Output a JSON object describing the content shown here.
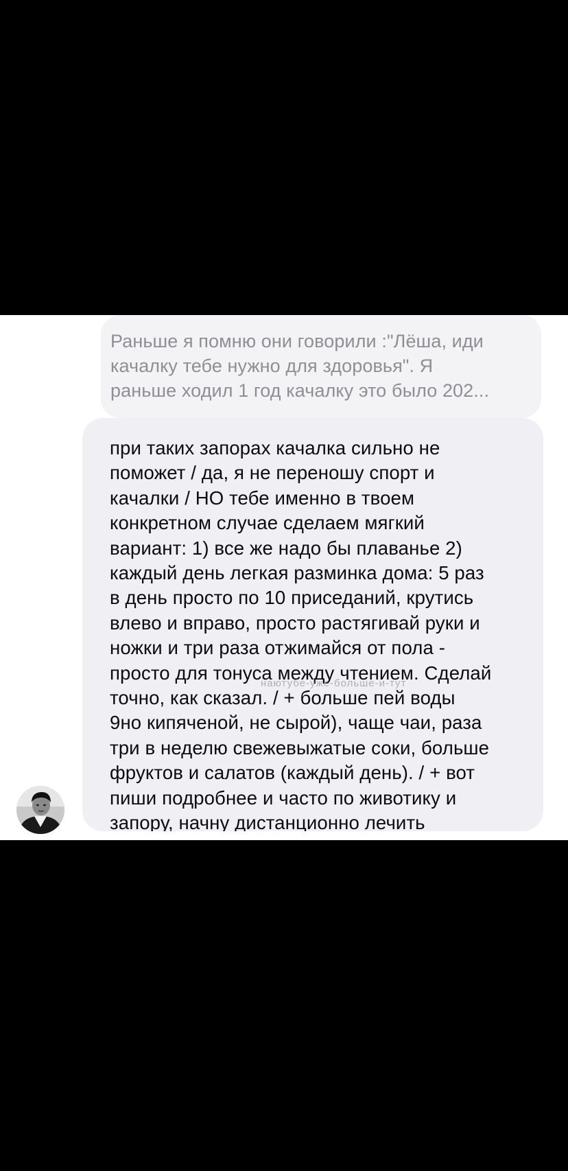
{
  "conversation": {
    "reply_quote": {
      "text": "Раньше я помню они говорили :\"Лёша, иди\nкачалку тебе нужно для здоровья\". Я\nраньше ходил 1 год качалку это было 202..."
    },
    "message": {
      "text": "при таких запорах качалка сильно не\nпоможет / да, я не переношу спорт и\nкачалки / НО тебе именно в твоем\nконкретном случае сделаем мягкий\nвариант: 1) все же надо бы плаванье 2)\nкаждый день легкая разминка дома: 5 раз\nв день просто по 10 приседаний, крутись\nвлево и вправо, просто растягивай руки и\nножки и три раза отжимайся от пола -\nпросто для тонуса между чтением. Сделай\nточно, как сказал. / + больше пей воды\n9но кипяченой, не сырой), чаще чаи, раза\nтри в неделю свежевыжатые соки, больше\nфруктов и салатов (каждый день). / + вот\nпиши подробнее и часто по животику и\nзапору, начну дистанционно лечить"
    },
    "sender_avatar": {
      "icon": "person-photo-icon"
    }
  },
  "colors": {
    "background": "#ffffff",
    "letterbox": "#000000",
    "bubble": "#f0f0f4",
    "quote_bubble": "#f3f3f6",
    "quote_text": "#8e8e95",
    "message_text": "#0c0c0e"
  }
}
